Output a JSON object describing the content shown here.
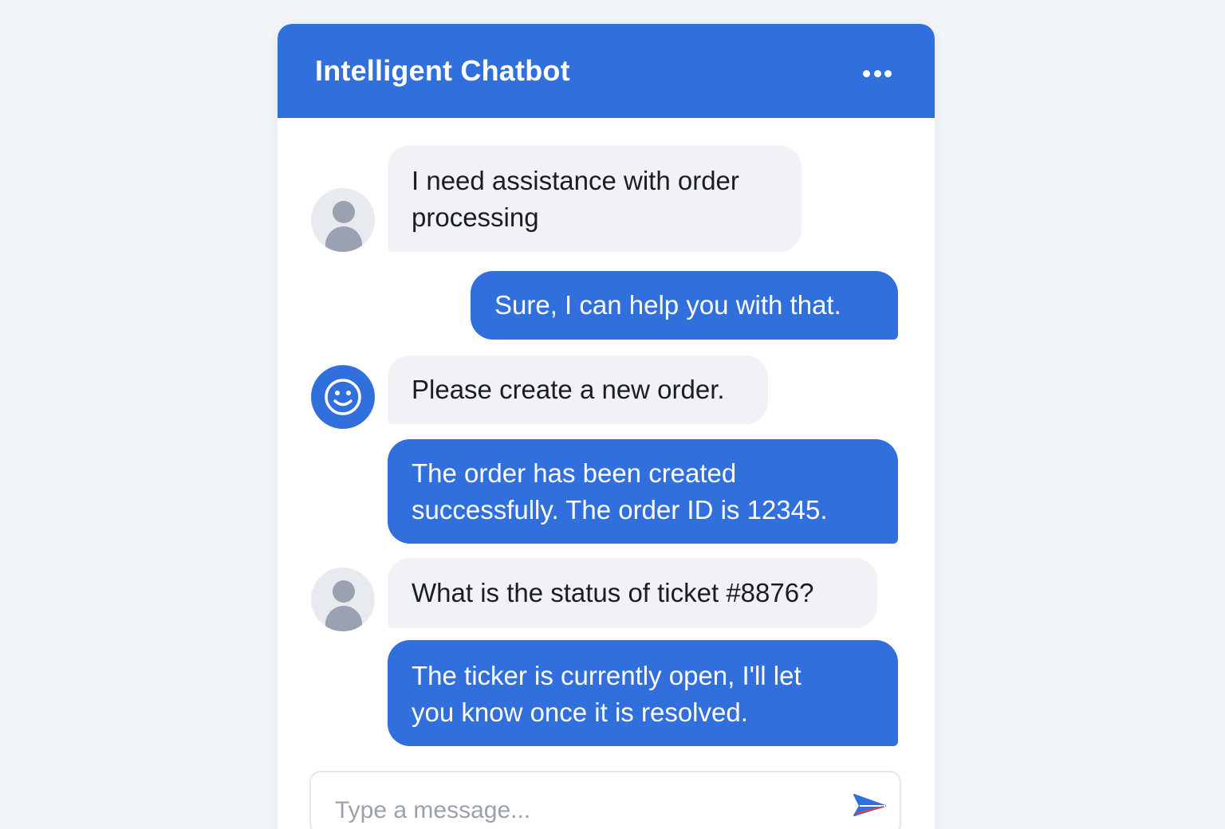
{
  "header": {
    "title": "Intelligent Chatbot",
    "menu_icon": "more-horizontal-icon",
    "color": "#3170dc"
  },
  "messages": [
    {
      "sender": "user",
      "avatar": "user-avatar-icon",
      "text": "I need assistance with order\nprocessing"
    },
    {
      "sender": "bot",
      "text": "Sure, I can help you with that."
    },
    {
      "sender": "bot",
      "avatar": "smiley-face-icon",
      "text": "Please create a new order."
    },
    {
      "sender": "bot",
      "text": "The order has been created\nsuccessfully. The order ID is 12345."
    },
    {
      "sender": "user",
      "avatar": "user-avatar-icon",
      "text": "What is the status of ticket #8876?"
    },
    {
      "sender": "bot",
      "text": "The ticker is currently open, I'll let\nyou know once it is resolved."
    }
  ],
  "composer": {
    "placeholder": "Type a message...",
    "value": "",
    "send_icon": "send-paper-plane-icon"
  },
  "colors": {
    "accent": "#3170dc",
    "incoming_bubble": "#f0f2f6",
    "page_background": "#f2f5f8"
  }
}
